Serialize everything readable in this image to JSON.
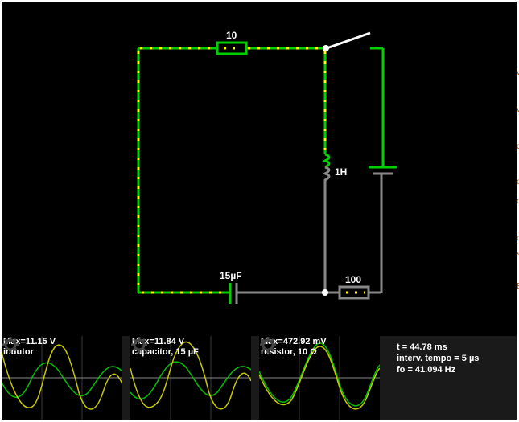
{
  "circuit": {
    "resistor_top_label": "10",
    "inductor_label": "1H",
    "capacitor_label": "15µF",
    "resistor_bottom_label": "100",
    "colors": {
      "active_wire": "#00cc00",
      "idle_wire": "#808080",
      "current_dot": "#ffff00",
      "background": "#000000"
    }
  },
  "scopes": [
    {
      "max": "Max=11.15 V",
      "name": "indutor"
    },
    {
      "max": "Max=11.84 V",
      "name": "capacitor, 15 µF"
    },
    {
      "max": "Max=472.92 mV",
      "name": "resistor, 10 Ω"
    }
  ],
  "info": {
    "time": "t = 44.78 ms",
    "interval": "interv. tempo = 5 µs",
    "frequency": "fo = 41.094 Hz"
  },
  "scope_icon": "gear-icon",
  "edge_letters": [
    "v",
    "v",
    "c",
    "c",
    "c",
    "d",
    "s",
    "E"
  ]
}
